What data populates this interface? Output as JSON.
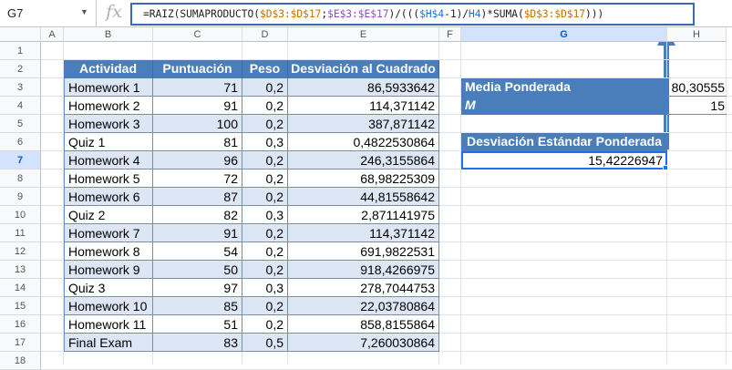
{
  "formula_bar": {
    "name_box": "G7",
    "fx": "fx",
    "formula_tokens": [
      {
        "t": "=RAIZ(SUMAPRODUCTO(",
        "c": ""
      },
      {
        "t": "$D$3:$D$17",
        "c": "tk-d"
      },
      {
        "t": ";",
        "c": ""
      },
      {
        "t": "$E$3:$E$17",
        "c": "tk-e"
      },
      {
        "t": ")/(((",
        "c": ""
      },
      {
        "t": "$H$4",
        "c": "tk-h"
      },
      {
        "t": "-1)/",
        "c": ""
      },
      {
        "t": "H4",
        "c": "tk-h"
      },
      {
        "t": ")*SUMA(",
        "c": ""
      },
      {
        "t": "$D$3:$D$17",
        "c": "tk-d"
      },
      {
        "t": ")))",
        "c": ""
      }
    ]
  },
  "columns": [
    "A",
    "B",
    "C",
    "D",
    "E",
    "F",
    "G",
    "H"
  ],
  "rows": [
    "1",
    "2",
    "3",
    "4",
    "5",
    "6",
    "7",
    "8",
    "9",
    "10",
    "11",
    "12",
    "13",
    "14",
    "15",
    "16",
    "17",
    "18"
  ],
  "table": {
    "headers": {
      "actividad": "Actividad",
      "puntuacion": "Puntuación",
      "peso": "Peso",
      "desviacion": "Desviación al Cuadrado"
    },
    "data": [
      {
        "actividad": "Homework 1",
        "puntuacion": "71",
        "peso": "0,2",
        "desviacion": "86,5933642"
      },
      {
        "actividad": "Homework 2",
        "puntuacion": "91",
        "peso": "0,2",
        "desviacion": "114,371142"
      },
      {
        "actividad": "Homework 3",
        "puntuacion": "100",
        "peso": "0,2",
        "desviacion": "387,871142"
      },
      {
        "actividad": "Quiz 1",
        "puntuacion": "81",
        "peso": "0,3",
        "desviacion": "0,4822530864"
      },
      {
        "actividad": "Homework 4",
        "puntuacion": "96",
        "peso": "0,2",
        "desviacion": "246,3155864"
      },
      {
        "actividad": "Homework 5",
        "puntuacion": "72",
        "peso": "0,2",
        "desviacion": "68,98225309"
      },
      {
        "actividad": "Homework 6",
        "puntuacion": "87",
        "peso": "0,2",
        "desviacion": "44,81558642"
      },
      {
        "actividad": "Quiz 2",
        "puntuacion": "82",
        "peso": "0,3",
        "desviacion": "2,871141975"
      },
      {
        "actividad": "Homework 7",
        "puntuacion": "91",
        "peso": "0,2",
        "desviacion": "114,371142"
      },
      {
        "actividad": "Homework 8",
        "puntuacion": "54",
        "peso": "0,2",
        "desviacion": "691,9822531"
      },
      {
        "actividad": "Homework 9",
        "puntuacion": "50",
        "peso": "0,2",
        "desviacion": "918,4266975"
      },
      {
        "actividad": "Quiz 3",
        "puntuacion": "97",
        "peso": "0,3",
        "desviacion": "278,7044753"
      },
      {
        "actividad": "Homework 10",
        "puntuacion": "85",
        "peso": "0,2",
        "desviacion": "22,03780864"
      },
      {
        "actividad": "Homework 11",
        "puntuacion": "51",
        "peso": "0,2",
        "desviacion": "858,8155864"
      },
      {
        "actividad": "Final Exam",
        "puntuacion": "83",
        "peso": "0,5",
        "desviacion": "7,260030864"
      }
    ]
  },
  "summary": {
    "media_label": "Media Ponderada",
    "media_value": "80,30555",
    "m_label": "M",
    "m_value": "15",
    "desv_label": "Desviación Estándar Ponderada",
    "desv_value": "15,42226947"
  },
  "colors": {
    "header_blue": "#4a7ebb",
    "alt_row": "#dce6f4",
    "arrow": "#4a7ebb",
    "selection": "#1a73e8"
  }
}
